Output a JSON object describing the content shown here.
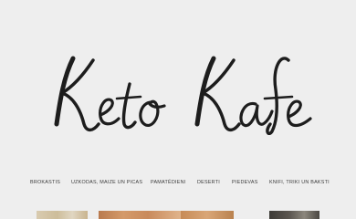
{
  "logo": {
    "text": "Keto Kafe"
  },
  "nav": {
    "items": [
      {
        "label": "BROKASTIS"
      },
      {
        "label": "UZKODAS, MAIZE UN PICAS"
      },
      {
        "label": "PAMATĒDIENI"
      },
      {
        "label": "DESERTI"
      },
      {
        "label": "PIEDEVAS"
      },
      {
        "label": "KNIFI, TRIKI UN BAKSTI"
      }
    ]
  },
  "thumbnails": [
    {
      "name": "recipe-thumbnail-1"
    },
    {
      "name": "recipe-thumbnail-2"
    },
    {
      "name": "recipe-thumbnail-3"
    },
    {
      "name": "recipe-thumbnail-4"
    }
  ]
}
